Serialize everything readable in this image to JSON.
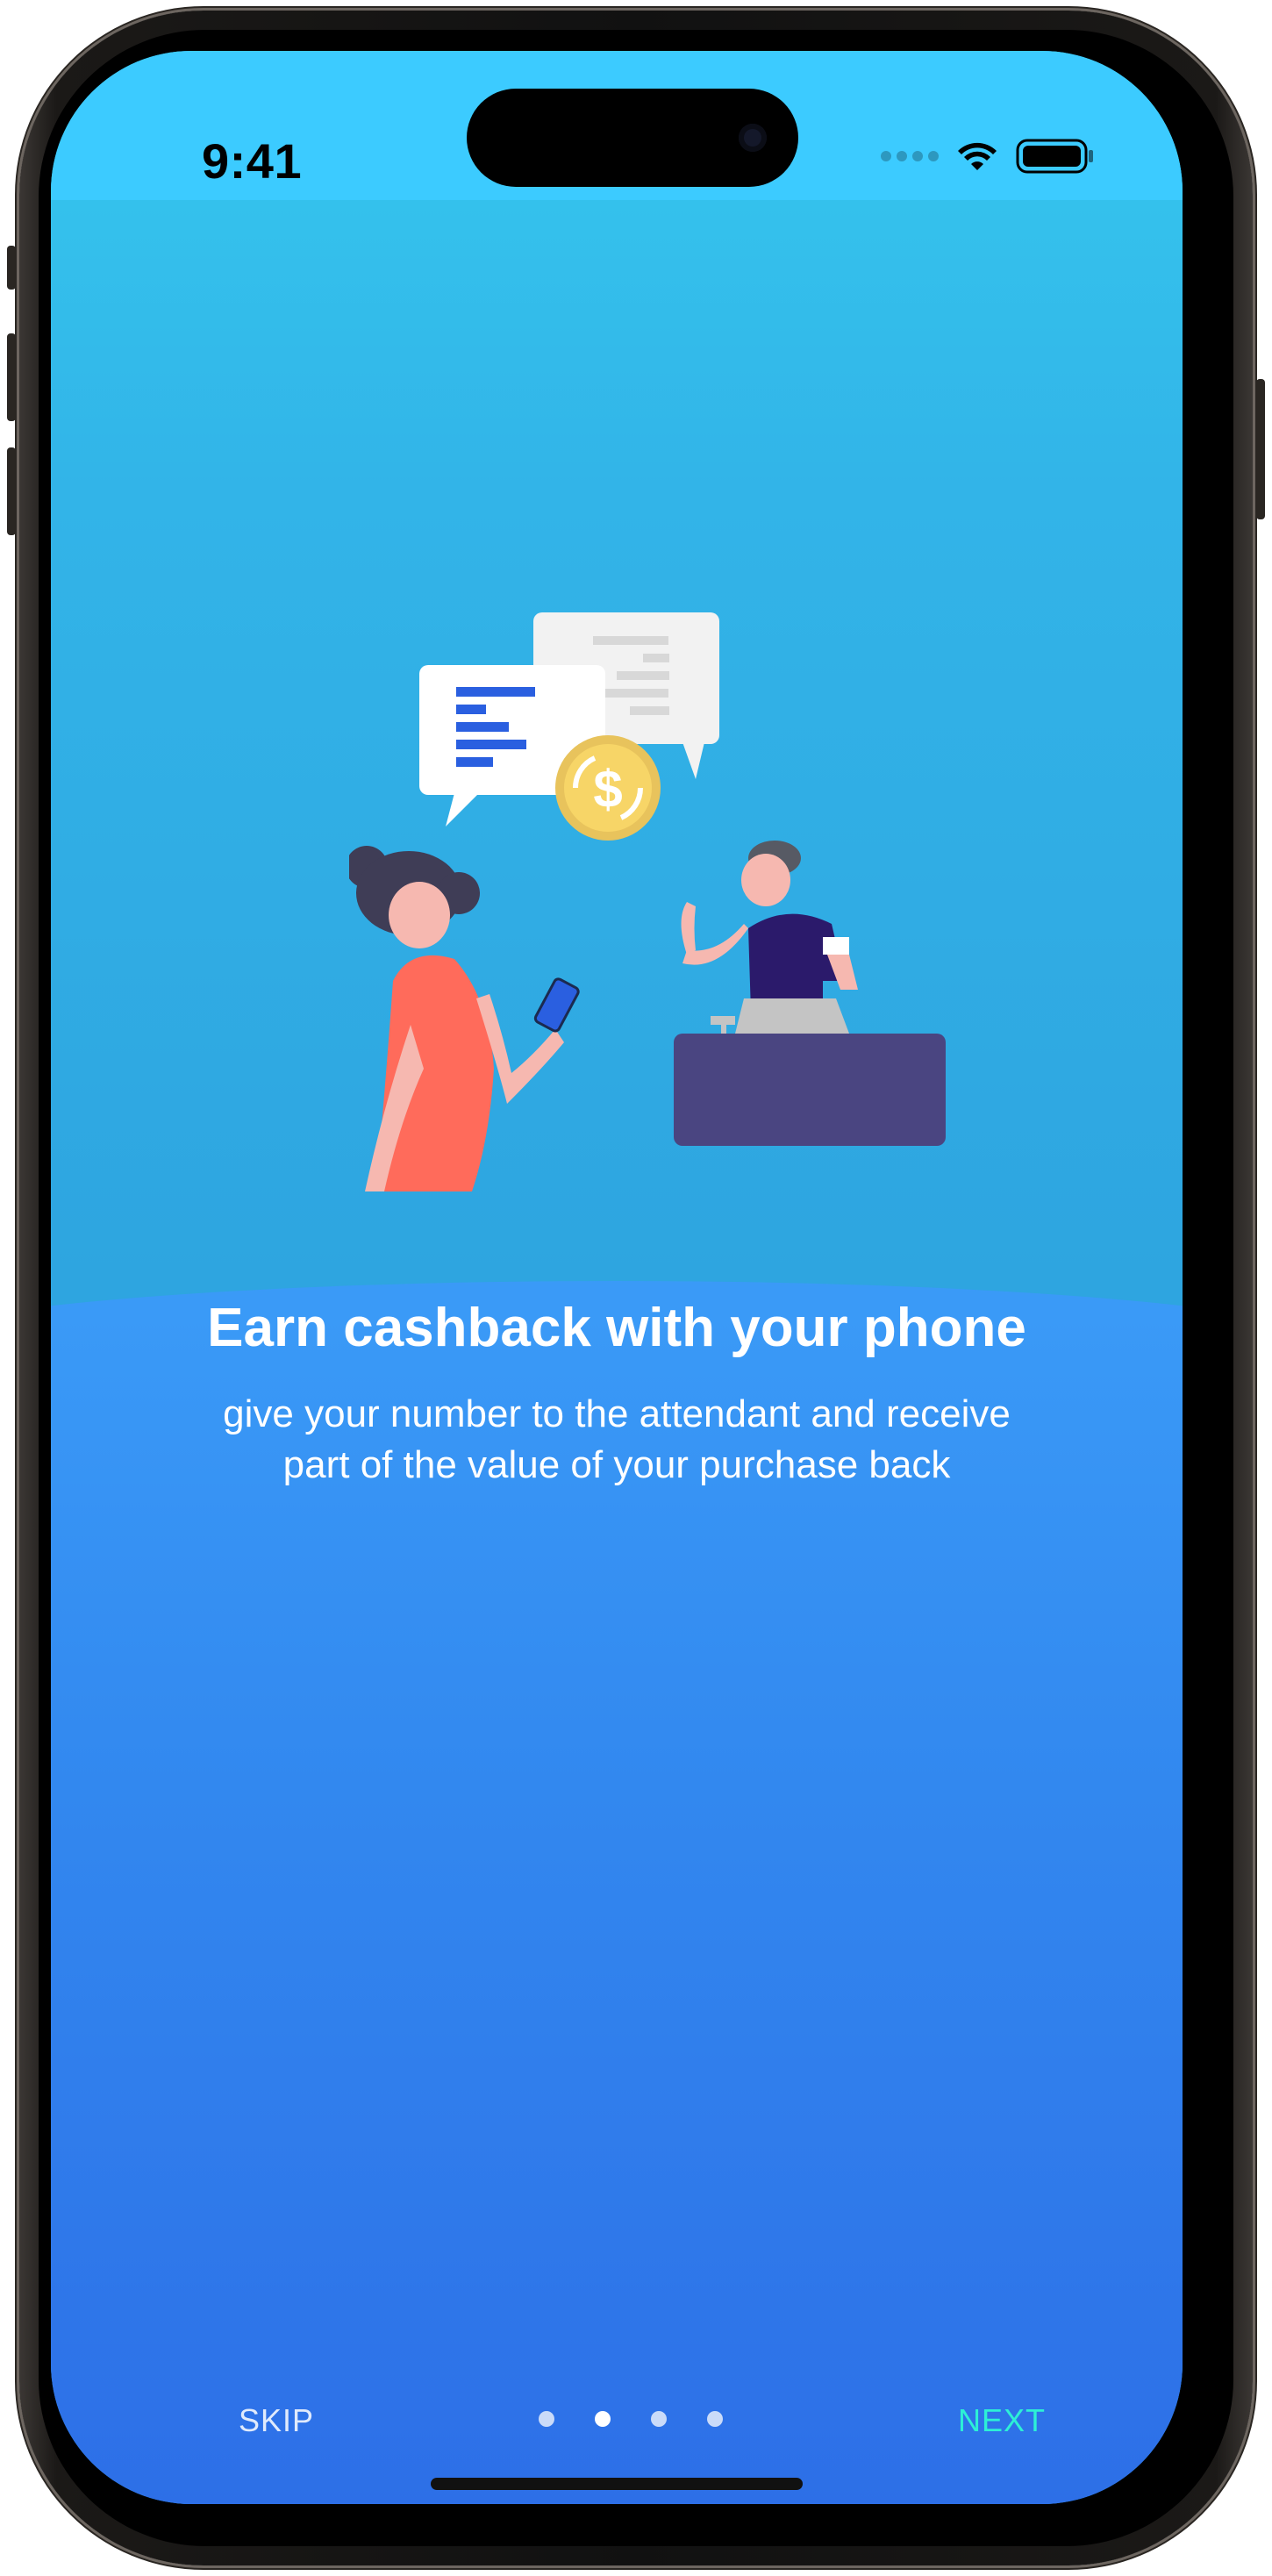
{
  "status_bar": {
    "time": "9:41"
  },
  "onboarding": {
    "title": "Earn cashback with your phone",
    "subtitle": "give your number to the attendant and receive part of the value of your purchase back",
    "illustration": "cashback-illustration",
    "page_index": 2,
    "page_count": 4
  },
  "nav": {
    "skip_label": "SKIP",
    "next_label": "NEXT"
  },
  "colors": {
    "accent": "#2df0d6",
    "background_top": "#35c8ee",
    "background_bottom": "#2d6fe7"
  }
}
